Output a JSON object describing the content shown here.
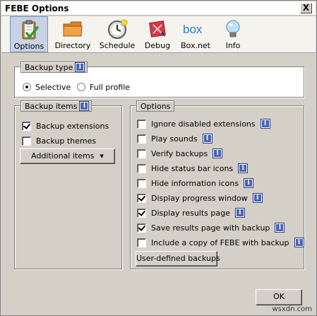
{
  "window": {
    "title": "FEBE Options",
    "close_glyph": "X"
  },
  "toolbar": {
    "items": [
      {
        "label": "Options",
        "icon": "clipboard-check-icon",
        "active": true
      },
      {
        "label": "Directory",
        "icon": "folder-icon"
      },
      {
        "label": "Schedule",
        "icon": "clock-icon"
      },
      {
        "label": "Debug",
        "icon": "debug-icon"
      },
      {
        "label": "Box.net",
        "icon": "box-logo-icon"
      },
      {
        "label": "Info",
        "icon": "lightbulb-icon"
      }
    ],
    "box_logo_text": "box"
  },
  "backup_type": {
    "label": "Backup type",
    "info_glyph": "i",
    "options": [
      {
        "label": "Selective",
        "selected": true
      },
      {
        "label": "Full profile",
        "selected": false
      }
    ]
  },
  "backup_items": {
    "label": "Backup items",
    "info_glyph": "i",
    "items": [
      {
        "label": "Backup extensions",
        "checked": true
      },
      {
        "label": "Backup themes",
        "checked": false
      }
    ],
    "additional_button": "Additional items",
    "additional_caret": "▼"
  },
  "options": {
    "label": "Options",
    "info_glyph": "i",
    "items": [
      {
        "label": "Ignore disabled extensions",
        "checked": false
      },
      {
        "label": "Play sounds",
        "checked": false
      },
      {
        "label": "Verify backups",
        "checked": false
      },
      {
        "label": "Hide status bar icons",
        "checked": false
      },
      {
        "label": "Hide information icons",
        "checked": false
      },
      {
        "label": "Display progress window",
        "checked": true
      },
      {
        "label": "Display results page",
        "checked": true
      },
      {
        "label": "Save results page with backup",
        "checked": true
      },
      {
        "label": "Include a copy of FEBE with backup",
        "checked": false
      }
    ],
    "user_defined_button": "User-defined backups"
  },
  "footer": {
    "ok_label": "OK",
    "watermark": "wsxdn.com"
  },
  "colors": {
    "active_tab": "#c7d2e6",
    "info_icon": "#4b64b3",
    "window": "#d4d0c8"
  }
}
